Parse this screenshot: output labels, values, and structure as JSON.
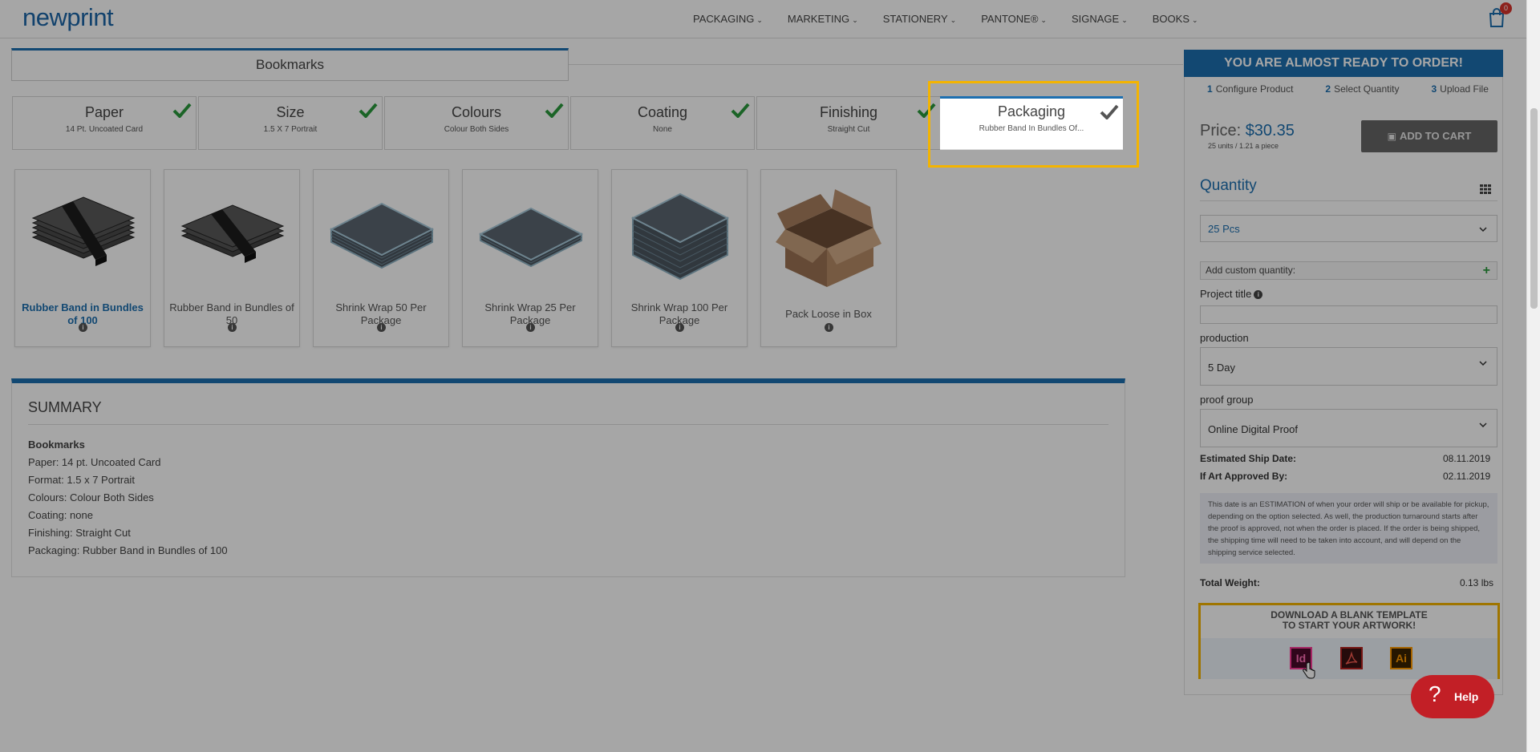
{
  "header": {
    "logo": "newprint",
    "nav": [
      "PACKAGING",
      "MARKETING",
      "STATIONERY",
      "PANTONE®",
      "SIGNAGE",
      "BOOKS"
    ],
    "cart_count": "0"
  },
  "product_title": "Bookmarks",
  "steps": [
    {
      "title": "Paper",
      "subtitle": "14 Pt. Uncoated Card"
    },
    {
      "title": "Size",
      "subtitle": "1.5 X 7 Portrait"
    },
    {
      "title": "Colours",
      "subtitle": "Colour Both Sides"
    },
    {
      "title": "Coating",
      "subtitle": "None"
    },
    {
      "title": "Finishing",
      "subtitle": "Straight Cut"
    }
  ],
  "active_step": {
    "title": "Packaging",
    "subtitle": "Rubber Band In Bundles Of..."
  },
  "options": [
    {
      "label": "Rubber Band in Bundles of 100",
      "icon": "rubber-band-bundle-100-icon"
    },
    {
      "label": "Rubber Band in Bundles of 50",
      "icon": "rubber-band-bundle-50-icon"
    },
    {
      "label": "Shrink Wrap 50 Per Package",
      "icon": "shrink-wrap-50-icon"
    },
    {
      "label": "Shrink Wrap 25 Per Package",
      "icon": "shrink-wrap-25-icon"
    },
    {
      "label": "Shrink Wrap 100 Per Package",
      "icon": "shrink-wrap-100-icon"
    },
    {
      "label": "Pack Loose in Box",
      "icon": "open-box-icon"
    }
  ],
  "summary": {
    "heading": "SUMMARY",
    "product": "Bookmarks",
    "lines": [
      "Paper: 14 pt. Uncoated Card",
      "Format: 1.5 x 7 Portrait",
      "Colours: Colour Both Sides",
      "Coating: none",
      "Finishing: Straight Cut",
      "Packaging: Rubber Band in Bundles of 100"
    ]
  },
  "order": {
    "banner": "YOU ARE ALMOST READY TO ORDER!",
    "steps": [
      {
        "num": "1",
        "label": "Configure Product"
      },
      {
        "num": "2",
        "label": "Select Quantity"
      },
      {
        "num": "3",
        "label": "Upload File"
      }
    ],
    "price_label": "Price:",
    "price_value": "$30.35",
    "price_sub": "25 units / 1.21 a piece",
    "add_to_cart": "ADD TO CART",
    "quantity_heading": "Quantity",
    "quantity_value": "25 Pcs",
    "custom_quantity": "Add custom quantity:",
    "project_title_label": "Project title",
    "production_label": "production",
    "production_value": "5 Day",
    "proof_group_label": "proof group",
    "proof_group_value": "Online Digital Proof",
    "ship_date_label": "Estimated Ship Date:",
    "ship_date_value": "08.11.2019",
    "approved_label": "If Art Approved By:",
    "approved_value": "02.11.2019",
    "note": "This date is an ESTIMATION of when your order will ship or be available for pickup, depending on the option selected. As well, the production turnaround starts after the proof is approved, not when the order is placed. If the order is being shipped, the shipping time will need to be taken into account, and will depend on the shipping service selected.",
    "weight_label": "Total Weight:",
    "weight_value": "0.13 lbs",
    "download_line1": "DOWNLOAD A BLANK TEMPLATE",
    "download_line2": "TO START YOUR ARTWORK!",
    "file_icons": [
      "Id",
      "Ai"
    ],
    "help": "Help"
  },
  "colors": {
    "brand_blue": "#1d6fb0",
    "check_green": "#2a9a3c",
    "highlight": "#f4b400",
    "help_red": "#c21f26"
  }
}
